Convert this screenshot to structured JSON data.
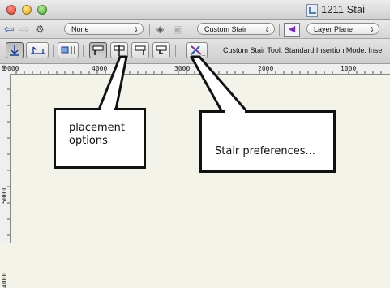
{
  "window": {
    "title": "1211 Stai"
  },
  "toolbar1": {
    "class_popup": "None",
    "stair_type_popup": "Custom Stair",
    "plane_popup": "Layer Plane"
  },
  "toolbar2": {
    "hint_text": "Custom Stair Tool: Standard Insertion Mode. Inse"
  },
  "rulers": {
    "top_labels": [
      "000",
      "4000",
      "3000",
      "2000",
      "1000"
    ],
    "left_labels": [
      "5000",
      "4000"
    ]
  },
  "callouts": {
    "placement_line1": "placement",
    "placement_line2": "options",
    "stair_prefs": "Stair preferences..."
  },
  "colors": {
    "canvas": "#f4f3e9",
    "callout_border": "#111111",
    "callout_fill": "#ffffff"
  },
  "icons": [
    "back-arrow-icon",
    "forward-arrow-icon",
    "class-icon",
    "layers-icon",
    "stair-tool-icon",
    "layer-plane-icon"
  ]
}
